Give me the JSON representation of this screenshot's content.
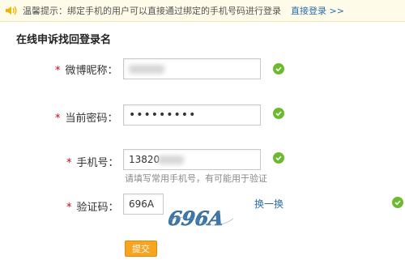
{
  "tip": {
    "text": "温馨提示：绑定手机的用户可以直接通过绑定的手机号码进行登录",
    "link": "直接登录 >>"
  },
  "section_title": "在线申诉找回登录名",
  "form": {
    "nickname": {
      "label": "微博昵称：",
      "value": ""
    },
    "password": {
      "label": "当前密码：",
      "value": "•••••••••"
    },
    "phone": {
      "label": "手机号：",
      "value": "13820",
      "hint": "请填写常用手机号，有可能用于验证"
    },
    "captcha": {
      "label": "验证码：",
      "value": "696A",
      "image_text": "696A",
      "refresh": "换一换"
    }
  },
  "submit_label": "提交",
  "colors": {
    "accent": "#f7a41f",
    "link": "#2a6db0",
    "required": "#d6000f",
    "valid": "#6dba2f"
  }
}
